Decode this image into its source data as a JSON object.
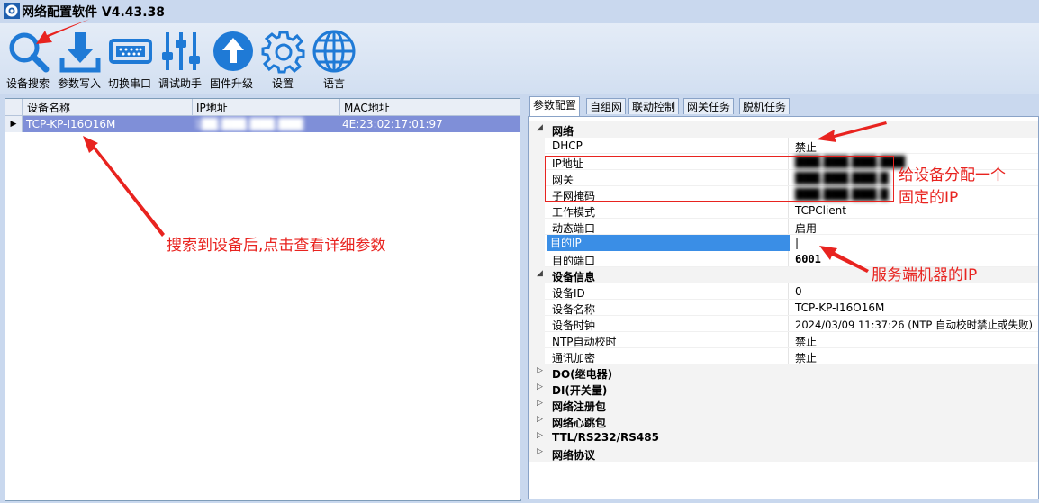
{
  "window": {
    "title": "网络配置软件 V4.43.38"
  },
  "toolbar": {
    "buttons": [
      {
        "label": "设备搜索",
        "icon": "search-icon"
      },
      {
        "label": "参数写入",
        "icon": "download-icon"
      },
      {
        "label": "切换串口",
        "icon": "serial-port-icon"
      },
      {
        "label": "调试助手",
        "icon": "sliders-icon"
      },
      {
        "label": "固件升级",
        "icon": "upgrade-icon"
      },
      {
        "label": "设置",
        "icon": "gear-icon"
      },
      {
        "label": "语言",
        "icon": "globe-icon"
      }
    ]
  },
  "device_table": {
    "columns": [
      "设备名称",
      "IP地址",
      "MAC地址"
    ],
    "rows": [
      {
        "name": "TCP-KP-I16O16M",
        "ip": "1██.███.███.███",
        "mac": "4E:23:02:17:01:97"
      }
    ]
  },
  "tabs": [
    "参数配置",
    "自组网",
    "联动控制",
    "网关任务",
    "脱机任务"
  ],
  "properties": {
    "network": {
      "title": "网络",
      "rows": [
        {
          "name": "DHCP",
          "value": "禁止"
        },
        {
          "name": "IP地址",
          "value": "███.███.███.███"
        },
        {
          "name": "网关",
          "value": "███.███.███.█"
        },
        {
          "name": "子网掩码",
          "value": "███.███.███.█"
        },
        {
          "name": "工作模式",
          "value": "TCPClient"
        },
        {
          "name": "动态端口",
          "value": "启用"
        },
        {
          "name": "目的IP",
          "value": "|"
        },
        {
          "name": "目的端口",
          "value": "6001"
        }
      ]
    },
    "device_info": {
      "title": "设备信息",
      "rows": [
        {
          "name": "设备ID",
          "value": "0"
        },
        {
          "name": "设备名称",
          "value": "TCP-KP-I16O16M"
        },
        {
          "name": "设备时钟",
          "value": "2024/03/09 11:37:26 (NTP 自动校时禁止或失败)"
        },
        {
          "name": "NTP自动校时",
          "value": "禁止"
        },
        {
          "name": "通讯加密",
          "value": "禁止"
        }
      ]
    },
    "collapsed": [
      "DO(继电器)",
      "DI(开关量)",
      "网络注册包",
      "网络心跳包",
      "TTL/RS232/RS485",
      "网络协议"
    ]
  },
  "annotations": {
    "search": "搜索到设备后,点击查看详细参数",
    "fixed_ip_1": "给设备分配一个",
    "fixed_ip_2": "固定的IP",
    "server_ip": "服务端机器的IP"
  },
  "colors": {
    "accent": "#1f7ad6",
    "annotation": "#e8231f",
    "selection": "#7f8fd8"
  }
}
